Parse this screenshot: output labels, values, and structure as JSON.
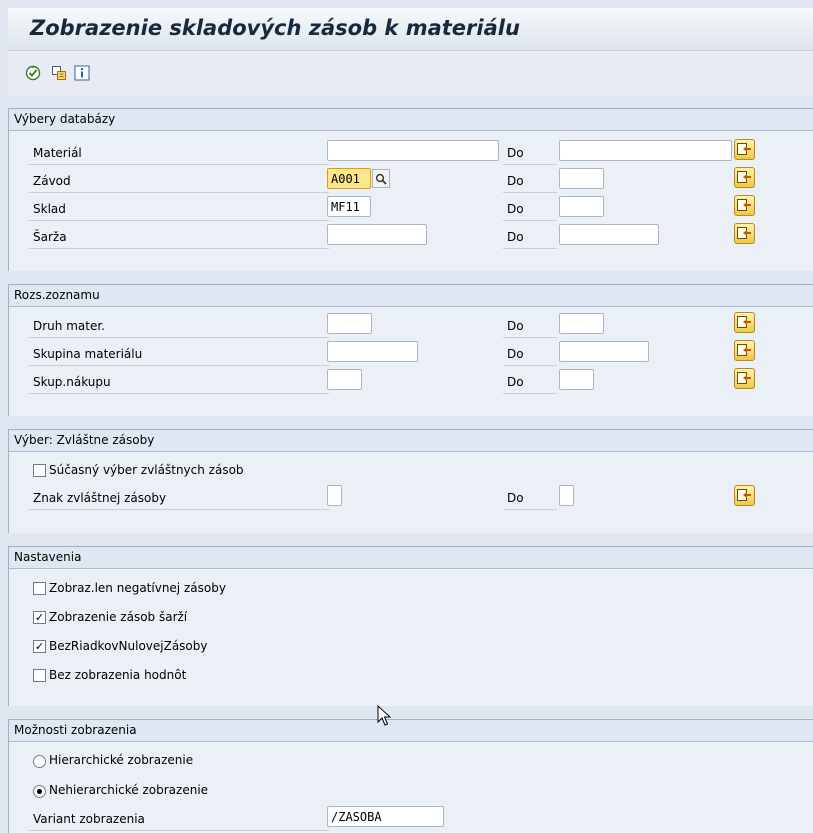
{
  "window": {
    "title": "Zobrazenie skladových zásob k materiálu"
  },
  "toolbar": {
    "icons": [
      "execute-icon",
      "copy-variant-icon",
      "info-icon"
    ]
  },
  "groups": {
    "database": {
      "title": "Výbery databázy",
      "rows": [
        {
          "label": "Materiál",
          "from": "",
          "to_label": "Do",
          "to": ""
        },
        {
          "label": "Závod",
          "from": "A001",
          "to_label": "Do",
          "to": ""
        },
        {
          "label": "Sklad",
          "from": "MF11",
          "to_label": "Do",
          "to": ""
        },
        {
          "label": "Šarža",
          "from": "",
          "to_label": "Do",
          "to": ""
        }
      ]
    },
    "list": {
      "title": "Rozs.zoznamu",
      "rows": [
        {
          "label": "Druh mater.",
          "from": "",
          "to_label": "Do",
          "to": ""
        },
        {
          "label": "Skupina materiálu",
          "from": "",
          "to_label": "Do",
          "to": ""
        },
        {
          "label": "Skup.nákupu",
          "from": "",
          "to_label": "Do",
          "to": ""
        }
      ]
    },
    "special": {
      "title": "Výber: Zvláštne zásoby",
      "checkbox_label": "Súčasný výber zvláštnych zásob",
      "checkbox_checked": false,
      "row": {
        "label": "Znak zvláštnej zásoby",
        "from": "",
        "to_label": "Do",
        "to": ""
      }
    },
    "settings": {
      "title": "Nastavenia",
      "options": [
        {
          "label": "Zobraz.len negatívnej zásoby",
          "checked": false
        },
        {
          "label": "Zobrazenie zásob šarží",
          "checked": true
        },
        {
          "label": "BezRiadkovNulovejZásoby",
          "checked": true
        },
        {
          "label": "Bez zobrazenia hodnôt",
          "checked": false
        }
      ]
    },
    "display": {
      "title": "Možnosti zobrazenia",
      "radios": [
        {
          "label": "Hierarchické zobrazenie",
          "selected": false
        },
        {
          "label": "Nehierarchické zobrazenie",
          "selected": true
        }
      ],
      "variant_label": "Variant zobrazenia",
      "variant_value": "/ZASOBA"
    }
  },
  "colors": {
    "background": "#dfe6ef",
    "group_header": "#dfe8f2",
    "focused_field": "#ffe68a",
    "multiselect_button": "#f0c845"
  }
}
